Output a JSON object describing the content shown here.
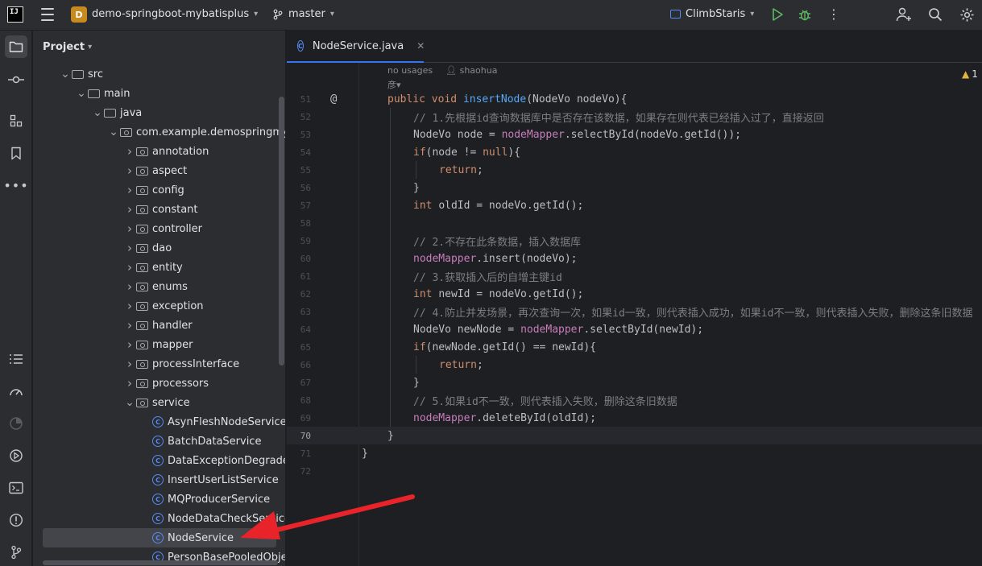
{
  "titlebar": {
    "logo_text": "IJ",
    "project_badge": "D",
    "project_name": "demo-springboot-mybatisplus",
    "branch": "master",
    "run_config": "ClimbStaris"
  },
  "panel": {
    "title": "Project"
  },
  "tree": [
    {
      "label": "src",
      "depth": 1,
      "kind": "folder",
      "chev": "v"
    },
    {
      "label": "main",
      "depth": 2,
      "kind": "folder",
      "chev": "v"
    },
    {
      "label": "java",
      "depth": 3,
      "kind": "folder",
      "chev": "v"
    },
    {
      "label": "com.example.demospringmyb",
      "depth": 4,
      "kind": "pkg",
      "chev": "v"
    },
    {
      "label": "annotation",
      "depth": 5,
      "kind": "pkg",
      "chev": ">"
    },
    {
      "label": "aspect",
      "depth": 5,
      "kind": "pkg",
      "chev": ">"
    },
    {
      "label": "config",
      "depth": 5,
      "kind": "pkg",
      "chev": ">"
    },
    {
      "label": "constant",
      "depth": 5,
      "kind": "pkg",
      "chev": ">"
    },
    {
      "label": "controller",
      "depth": 5,
      "kind": "pkg",
      "chev": ">"
    },
    {
      "label": "dao",
      "depth": 5,
      "kind": "pkg",
      "chev": ">"
    },
    {
      "label": "entity",
      "depth": 5,
      "kind": "pkg",
      "chev": ">"
    },
    {
      "label": "enums",
      "depth": 5,
      "kind": "pkg",
      "chev": ">"
    },
    {
      "label": "exception",
      "depth": 5,
      "kind": "pkg",
      "chev": ">"
    },
    {
      "label": "handler",
      "depth": 5,
      "kind": "pkg",
      "chev": ">"
    },
    {
      "label": "mapper",
      "depth": 5,
      "kind": "pkg",
      "chev": ">"
    },
    {
      "label": "processInterface",
      "depth": 5,
      "kind": "pkg",
      "chev": ">"
    },
    {
      "label": "processors",
      "depth": 5,
      "kind": "pkg",
      "chev": ">"
    },
    {
      "label": "service",
      "depth": 5,
      "kind": "pkg",
      "chev": "v"
    },
    {
      "label": "AsynFleshNodeService",
      "depth": 6,
      "kind": "class",
      "chev": ""
    },
    {
      "label": "BatchDataService",
      "depth": 6,
      "kind": "class",
      "chev": ""
    },
    {
      "label": "DataExceptionDegradeH",
      "depth": 6,
      "kind": "class",
      "chev": ""
    },
    {
      "label": "InsertUserListService",
      "depth": 6,
      "kind": "class",
      "chev": ""
    },
    {
      "label": "MQProducerService",
      "depth": 6,
      "kind": "class",
      "chev": ""
    },
    {
      "label": "NodeDataCheckService",
      "depth": 6,
      "kind": "class",
      "chev": ""
    },
    {
      "label": "NodeService",
      "depth": 6,
      "kind": "class",
      "chev": "",
      "selected": true
    },
    {
      "label": "PersonBasePooledObjec",
      "depth": 6,
      "kind": "class",
      "chev": ""
    }
  ],
  "editor": {
    "tab_label": "NodeService.java",
    "usages_hint": "no usages",
    "author_hint": "shaohua",
    "warning_count": "1",
    "annotation_marker": "@",
    "lines": [
      {
        "n": "51",
        "indent": 0,
        "tokens": [
          [
            "kw",
            "public "
          ],
          [
            "kw",
            "void "
          ],
          [
            "fn",
            "insertNode"
          ],
          [
            "",
            "(NodeVo nodeVo){"
          ]
        ]
      },
      {
        "n": "52",
        "indent": 1,
        "tokens": [
          [
            "cm",
            "// 1.先根据id查询数据库中是否存在该数据，如果存在则代表已经插入过了，直接返回"
          ]
        ]
      },
      {
        "n": "53",
        "indent": 1,
        "tokens": [
          [
            "",
            "NodeVo node = "
          ],
          [
            "fld",
            "nodeMapper"
          ],
          [
            "",
            ".selectById(nodeVo.getId());"
          ]
        ]
      },
      {
        "n": "54",
        "indent": 1,
        "tokens": [
          [
            "kw",
            "if"
          ],
          [
            "",
            "(node != "
          ],
          [
            "kw",
            "null"
          ],
          [
            "",
            "){"
          ]
        ]
      },
      {
        "n": "55",
        "indent": 2,
        "tokens": [
          [
            "kw",
            "return"
          ],
          [
            "",
            ";"
          ]
        ]
      },
      {
        "n": "56",
        "indent": 1,
        "tokens": [
          [
            "",
            "}"
          ]
        ]
      },
      {
        "n": "57",
        "indent": 1,
        "tokens": [
          [
            "kw",
            "int "
          ],
          [
            "",
            "oldId = nodeVo.getId();"
          ]
        ]
      },
      {
        "n": "58",
        "indent": 1,
        "tokens": []
      },
      {
        "n": "59",
        "indent": 1,
        "tokens": [
          [
            "cm",
            "// 2.不存在此条数据，插入数据库"
          ]
        ]
      },
      {
        "n": "60",
        "indent": 1,
        "tokens": [
          [
            "fld",
            "nodeMapper"
          ],
          [
            "",
            ".insert(nodeVo);"
          ]
        ]
      },
      {
        "n": "61",
        "indent": 1,
        "tokens": [
          [
            "cm",
            "// 3.获取插入后的自增主键id"
          ]
        ]
      },
      {
        "n": "62",
        "indent": 1,
        "tokens": [
          [
            "kw",
            "int "
          ],
          [
            "",
            "newId = nodeVo.getId();"
          ]
        ]
      },
      {
        "n": "63",
        "indent": 1,
        "tokens": [
          [
            "cm",
            "// 4.防止并发场景，再次查询一次，如果id一致，则代表插入成功，如果id不一致，则代表插入失败，删除这条旧数据"
          ]
        ]
      },
      {
        "n": "64",
        "indent": 1,
        "tokens": [
          [
            "",
            "NodeVo newNode = "
          ],
          [
            "fld",
            "nodeMapper"
          ],
          [
            "",
            ".selectById(newId);"
          ]
        ]
      },
      {
        "n": "65",
        "indent": 1,
        "tokens": [
          [
            "kw",
            "if"
          ],
          [
            "",
            "(newNode.getId() == newId){"
          ]
        ]
      },
      {
        "n": "66",
        "indent": 2,
        "tokens": [
          [
            "kw",
            "return"
          ],
          [
            "",
            ";"
          ]
        ]
      },
      {
        "n": "67",
        "indent": 1,
        "tokens": [
          [
            "",
            "}"
          ]
        ]
      },
      {
        "n": "68",
        "indent": 1,
        "tokens": [
          [
            "cm",
            "// 5.如果id不一致，则代表插入失败，删除这条旧数据"
          ]
        ]
      },
      {
        "n": "69",
        "indent": 1,
        "tokens": [
          [
            "fld",
            "nodeMapper"
          ],
          [
            "",
            ".deleteById(oldId);"
          ]
        ]
      },
      {
        "n": "70",
        "indent": 0,
        "tokens": [
          [
            "",
            "}"
          ]
        ],
        "current": true
      },
      {
        "n": "71",
        "indent": -1,
        "tokens": [
          [
            "",
            "}"
          ]
        ]
      },
      {
        "n": "72",
        "indent": 0,
        "tokens": []
      }
    ]
  },
  "colors": {
    "accent": "#3574f0",
    "arrow": "#e8242a",
    "keyword": "#cf8e6d",
    "method": "#56a8f5",
    "field": "#c77dbb",
    "comment": "#7a7e85"
  }
}
